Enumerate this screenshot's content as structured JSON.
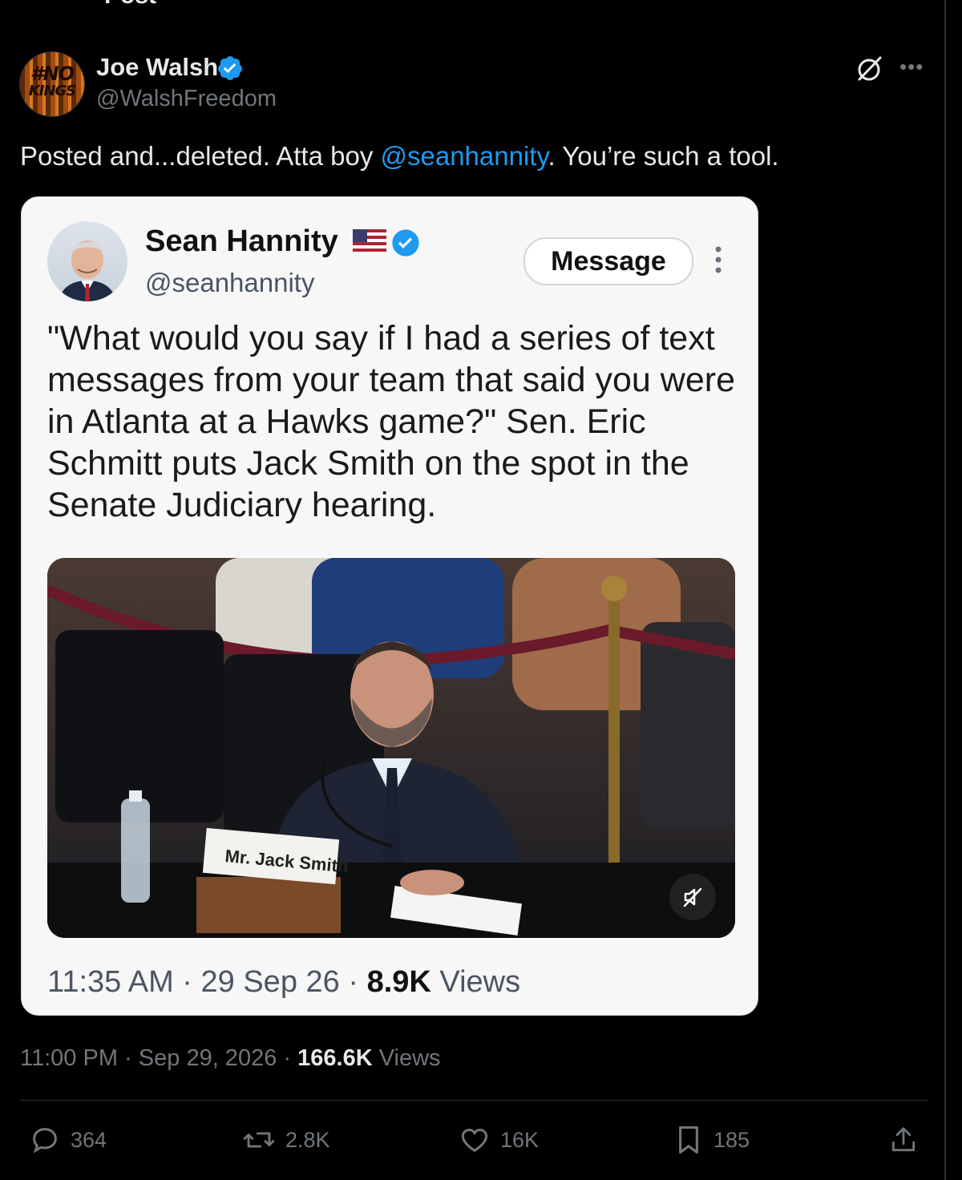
{
  "page": {
    "partial_title": "Post"
  },
  "author": {
    "name": "Joe Walsh",
    "handle": "@WalshFreedom",
    "avatar_text_line1": "#NO",
    "avatar_text_line2": "KINGS",
    "verified": true
  },
  "tweet": {
    "text_before": "Posted and...deleted. Atta boy ",
    "mention": "@seanhannity",
    "text_after": ". You’re such a tool."
  },
  "embedded": {
    "name": "Sean Hannity",
    "handle": "@seanhannity",
    "message_button": "Message",
    "text": "\"What would you say if I had a series of text messages from your team that said you were in Atlanta at a Hawks game?\" Sen. Eric Schmitt puts Jack Smith on the spot in the Senate Judiciary hearing.",
    "nameplate": "Mr. Jack Smith",
    "time": "11:35 AM",
    "date": "29 Sep 26",
    "views_count": "8.9K",
    "views_label": "Views",
    "separator": "·"
  },
  "meta": {
    "time": "11:00 PM",
    "date": "Sep 29, 2026",
    "views_count": "166.6K",
    "views_label": "Views",
    "separator": "·"
  },
  "actions": {
    "replies": "364",
    "reposts": "2.8K",
    "likes": "16K",
    "bookmarks": "185"
  },
  "colors": {
    "background": "#000000",
    "text": "#e7e9ea",
    "muted": "#71767b",
    "accent": "#1d9bf0"
  },
  "icons": [
    "verified-badge-icon",
    "grok-icon",
    "more-icon",
    "reply-icon",
    "repost-icon",
    "like-icon",
    "bookmark-icon",
    "share-icon",
    "mute-icon"
  ]
}
